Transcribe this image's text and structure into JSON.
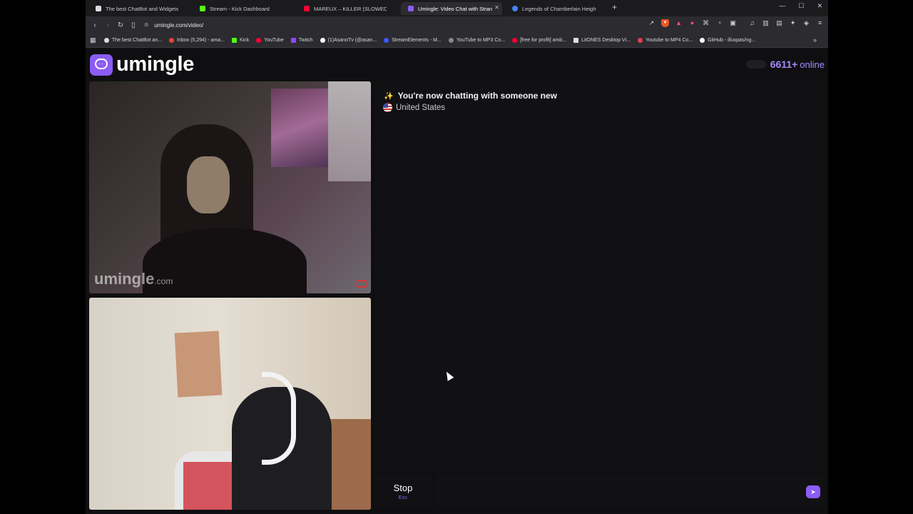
{
  "browser": {
    "tabs": [
      {
        "title": "The best ChatBot and Widgets for Kick",
        "color": "#dddddd",
        "active": false
      },
      {
        "title": "Stream - Kick Dashboard",
        "color": "#53fc18",
        "active": false
      },
      {
        "title": "MAREUX – KILLER (SLOWED) - YouTube",
        "color": "#ff0033",
        "active": false
      },
      {
        "title": "Umingle: Video Chat with Strangers",
        "color": "#8b5cf6",
        "active": true
      },
      {
        "title": "Legends of Chamberlain Heights Season",
        "color": "#4285f4",
        "active": false
      }
    ],
    "url": "umingle.com/video/",
    "bookmarks": [
      {
        "label": "The best ChatBot an...",
        "color": "#dddddd"
      },
      {
        "label": "Inbox (5,294) - ama...",
        "color": "#ea4335"
      },
      {
        "label": "Kick",
        "color": "#53fc18"
      },
      {
        "label": "YouTube",
        "color": "#ff0033"
      },
      {
        "label": "Twitch",
        "color": "#9146ff"
      },
      {
        "label": "(1)AsanoTv (@asan...",
        "color": "#ffffff"
      },
      {
        "label": "StreamElements - M...",
        "color": "#3c5afe"
      },
      {
        "label": "YouTube to MP3 Co...",
        "color": "#888888"
      },
      {
        "label": "[free for profit] amb...",
        "color": "#ff0033"
      },
      {
        "label": "LitONES Desktop Vi...",
        "color": "#dddddd"
      },
      {
        "label": "Youtube to MP4 Co...",
        "color": "#e04050"
      },
      {
        "label": "GitHub - illuspas/ng...",
        "color": "#ffffff"
      }
    ],
    "new_tab_icon": "plus-icon"
  },
  "header": {
    "brand": "umingle",
    "online_count": "6611+",
    "online_label": "online"
  },
  "stranger_video": {
    "watermark": "umingle",
    "watermark_tld": ".com"
  },
  "chat": {
    "system_message": "You're now chatting with someone new",
    "country": "United States"
  },
  "controls": {
    "stop_label": "Stop",
    "stop_hint": "Esc",
    "message_placeholder": ""
  },
  "colors": {
    "accent": "#8b5cf6",
    "online": "#a78bfa",
    "page_bg": "#0f0f11",
    "panel_bg": "#111114"
  }
}
